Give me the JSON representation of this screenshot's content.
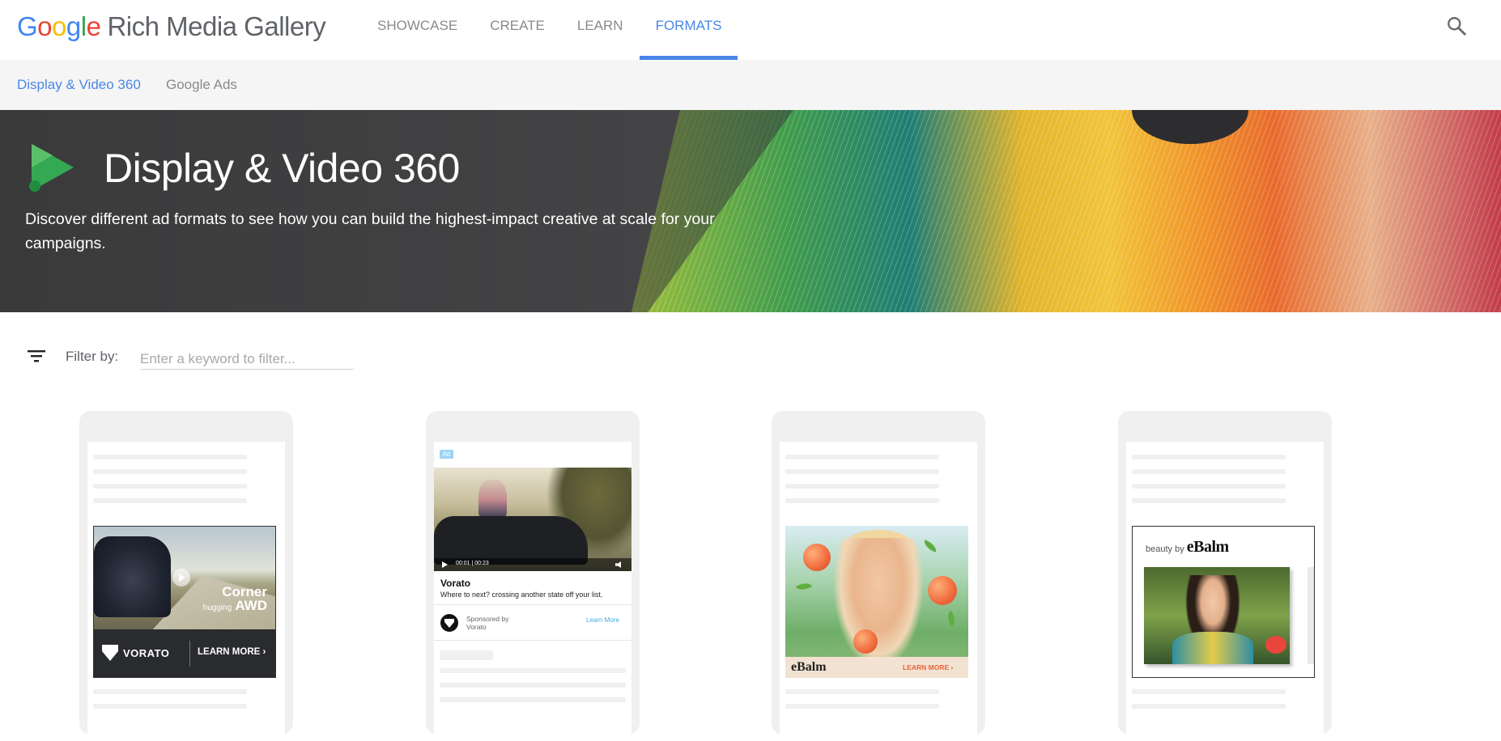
{
  "header": {
    "logo": {
      "g": "G",
      "o1": "o",
      "o2": "o",
      "g2": "g",
      "l": "l",
      "e": "e",
      "rest": "Rich Media Gallery"
    },
    "tabs": [
      {
        "label": "SHOWCASE",
        "active": false
      },
      {
        "label": "CREATE",
        "active": false
      },
      {
        "label": "LEARN",
        "active": false
      },
      {
        "label": "FORMATS",
        "active": true
      }
    ],
    "search_icon": "search-icon",
    "accent_color": "#4a86e8"
  },
  "subnav": {
    "items": [
      {
        "label": "Display & Video 360",
        "active": true
      },
      {
        "label": "Google Ads",
        "active": false
      }
    ]
  },
  "hero": {
    "title": "Display & Video 360",
    "description": "Discover different ad formats to see how you can build the highest-impact creative at scale for your campaigns.",
    "icon": "dv360-play-icon"
  },
  "filter": {
    "label": "Filter by:",
    "placeholder": "Enter a keyword to filter...",
    "value": ""
  },
  "cards": [
    {
      "ad": {
        "headline_1": "Corner",
        "headline_2": "hugging",
        "headline_3": "AWD",
        "brand": "VORATO",
        "cta": "LEARN MORE ›"
      }
    },
    {
      "ad": {
        "badge": "Ad",
        "video_time": "00:01 | 00:23",
        "name": "Vorato",
        "tagline": "Where to next? crossing another state off your list.",
        "sponsored": "Sponsored by\nVorato",
        "cta": "Learn More"
      }
    },
    {
      "ad": {
        "brand": "eBalm",
        "cta": "LEARN MORE ›"
      }
    },
    {
      "ad": {
        "prefix": "beauty by",
        "brand": "eBalm"
      }
    }
  ]
}
